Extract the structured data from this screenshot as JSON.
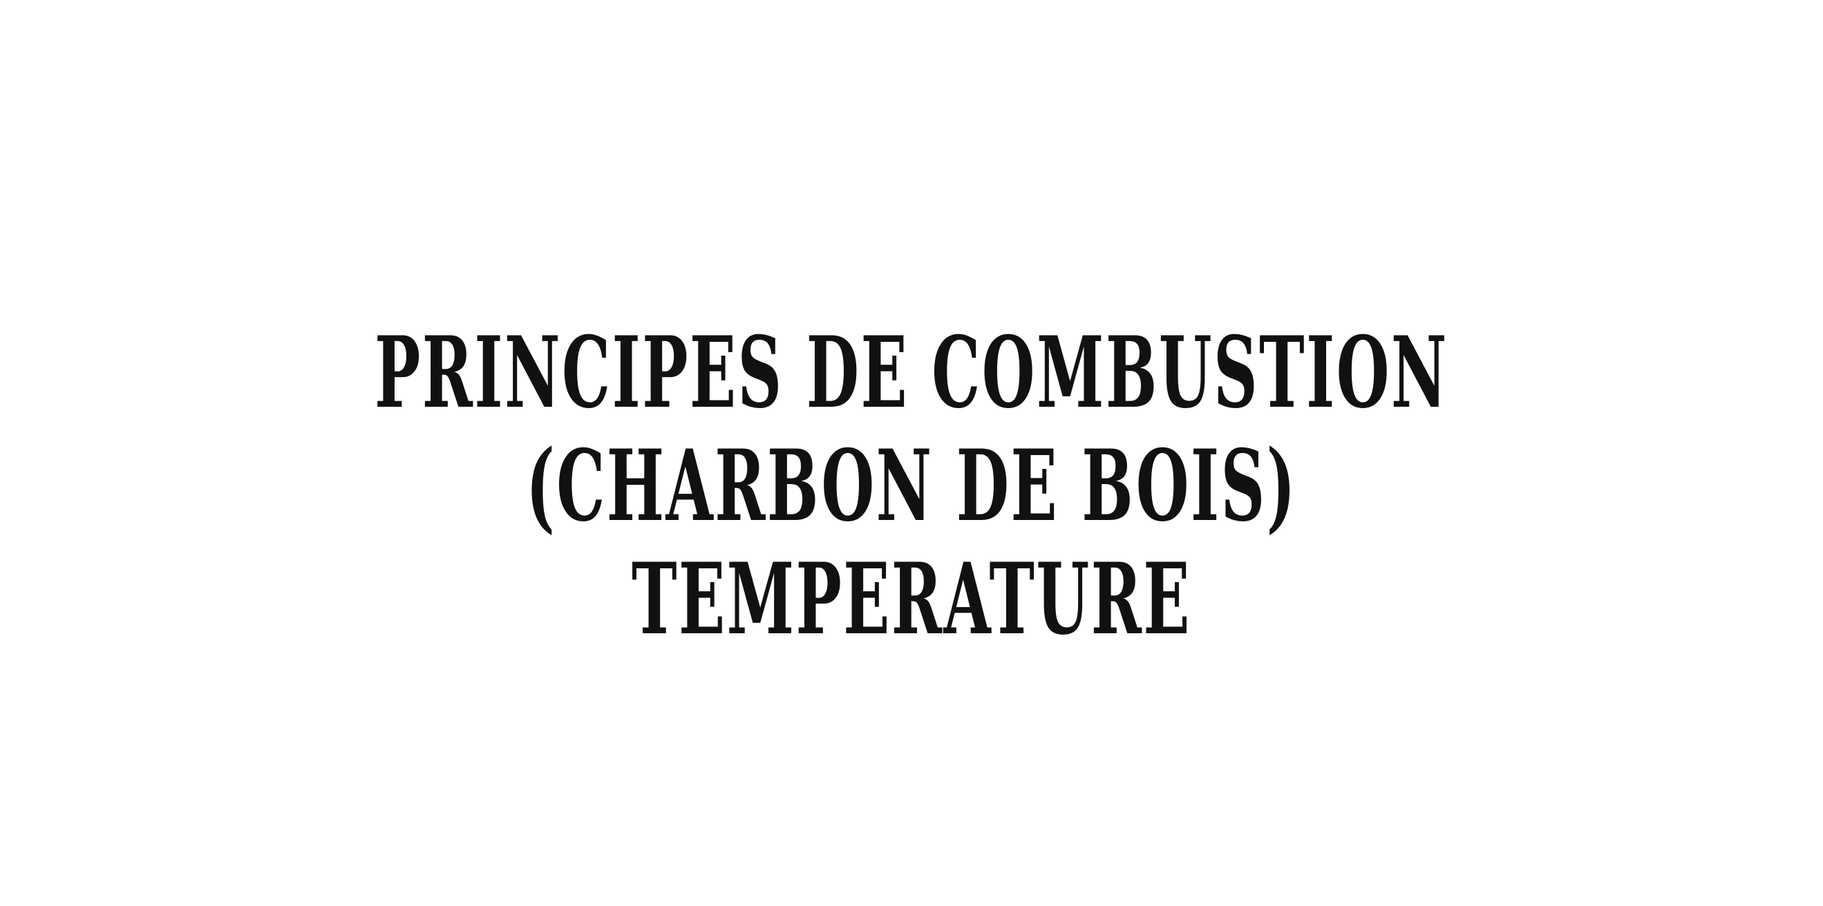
{
  "slide": {
    "background": "#ffffff",
    "text_color": "#111111",
    "title_lines": [
      "PRINCIPES DE COMBUSTION",
      "(CHARBON DE BOIS)",
      "TEMPERATURE"
    ]
  }
}
